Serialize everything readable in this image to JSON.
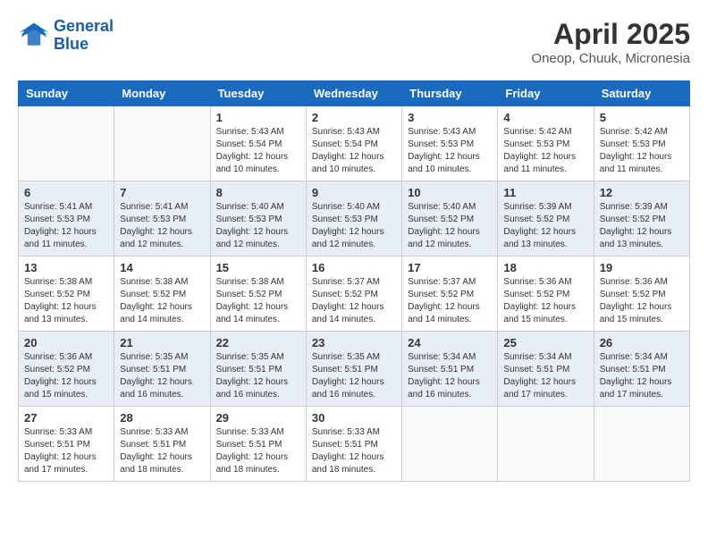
{
  "header": {
    "logo_line1": "General",
    "logo_line2": "Blue",
    "month": "April 2025",
    "location": "Oneop, Chuuk, Micronesia"
  },
  "weekdays": [
    "Sunday",
    "Monday",
    "Tuesday",
    "Wednesday",
    "Thursday",
    "Friday",
    "Saturday"
  ],
  "weeks": [
    [
      {
        "day": "",
        "info": ""
      },
      {
        "day": "",
        "info": ""
      },
      {
        "day": "1",
        "info": "Sunrise: 5:43 AM\nSunset: 5:54 PM\nDaylight: 12 hours\nand 10 minutes."
      },
      {
        "day": "2",
        "info": "Sunrise: 5:43 AM\nSunset: 5:54 PM\nDaylight: 12 hours\nand 10 minutes."
      },
      {
        "day": "3",
        "info": "Sunrise: 5:43 AM\nSunset: 5:53 PM\nDaylight: 12 hours\nand 10 minutes."
      },
      {
        "day": "4",
        "info": "Sunrise: 5:42 AM\nSunset: 5:53 PM\nDaylight: 12 hours\nand 11 minutes."
      },
      {
        "day": "5",
        "info": "Sunrise: 5:42 AM\nSunset: 5:53 PM\nDaylight: 12 hours\nand 11 minutes."
      }
    ],
    [
      {
        "day": "6",
        "info": "Sunrise: 5:41 AM\nSunset: 5:53 PM\nDaylight: 12 hours\nand 11 minutes."
      },
      {
        "day": "7",
        "info": "Sunrise: 5:41 AM\nSunset: 5:53 PM\nDaylight: 12 hours\nand 12 minutes."
      },
      {
        "day": "8",
        "info": "Sunrise: 5:40 AM\nSunset: 5:53 PM\nDaylight: 12 hours\nand 12 minutes."
      },
      {
        "day": "9",
        "info": "Sunrise: 5:40 AM\nSunset: 5:53 PM\nDaylight: 12 hours\nand 12 minutes."
      },
      {
        "day": "10",
        "info": "Sunrise: 5:40 AM\nSunset: 5:52 PM\nDaylight: 12 hours\nand 12 minutes."
      },
      {
        "day": "11",
        "info": "Sunrise: 5:39 AM\nSunset: 5:52 PM\nDaylight: 12 hours\nand 13 minutes."
      },
      {
        "day": "12",
        "info": "Sunrise: 5:39 AM\nSunset: 5:52 PM\nDaylight: 12 hours\nand 13 minutes."
      }
    ],
    [
      {
        "day": "13",
        "info": "Sunrise: 5:38 AM\nSunset: 5:52 PM\nDaylight: 12 hours\nand 13 minutes."
      },
      {
        "day": "14",
        "info": "Sunrise: 5:38 AM\nSunset: 5:52 PM\nDaylight: 12 hours\nand 14 minutes."
      },
      {
        "day": "15",
        "info": "Sunrise: 5:38 AM\nSunset: 5:52 PM\nDaylight: 12 hours\nand 14 minutes."
      },
      {
        "day": "16",
        "info": "Sunrise: 5:37 AM\nSunset: 5:52 PM\nDaylight: 12 hours\nand 14 minutes."
      },
      {
        "day": "17",
        "info": "Sunrise: 5:37 AM\nSunset: 5:52 PM\nDaylight: 12 hours\nand 14 minutes."
      },
      {
        "day": "18",
        "info": "Sunrise: 5:36 AM\nSunset: 5:52 PM\nDaylight: 12 hours\nand 15 minutes."
      },
      {
        "day": "19",
        "info": "Sunrise: 5:36 AM\nSunset: 5:52 PM\nDaylight: 12 hours\nand 15 minutes."
      }
    ],
    [
      {
        "day": "20",
        "info": "Sunrise: 5:36 AM\nSunset: 5:52 PM\nDaylight: 12 hours\nand 15 minutes."
      },
      {
        "day": "21",
        "info": "Sunrise: 5:35 AM\nSunset: 5:51 PM\nDaylight: 12 hours\nand 16 minutes."
      },
      {
        "day": "22",
        "info": "Sunrise: 5:35 AM\nSunset: 5:51 PM\nDaylight: 12 hours\nand 16 minutes."
      },
      {
        "day": "23",
        "info": "Sunrise: 5:35 AM\nSunset: 5:51 PM\nDaylight: 12 hours\nand 16 minutes."
      },
      {
        "day": "24",
        "info": "Sunrise: 5:34 AM\nSunset: 5:51 PM\nDaylight: 12 hours\nand 16 minutes."
      },
      {
        "day": "25",
        "info": "Sunrise: 5:34 AM\nSunset: 5:51 PM\nDaylight: 12 hours\nand 17 minutes."
      },
      {
        "day": "26",
        "info": "Sunrise: 5:34 AM\nSunset: 5:51 PM\nDaylight: 12 hours\nand 17 minutes."
      }
    ],
    [
      {
        "day": "27",
        "info": "Sunrise: 5:33 AM\nSunset: 5:51 PM\nDaylight: 12 hours\nand 17 minutes."
      },
      {
        "day": "28",
        "info": "Sunrise: 5:33 AM\nSunset: 5:51 PM\nDaylight: 12 hours\nand 18 minutes."
      },
      {
        "day": "29",
        "info": "Sunrise: 5:33 AM\nSunset: 5:51 PM\nDaylight: 12 hours\nand 18 minutes."
      },
      {
        "day": "30",
        "info": "Sunrise: 5:33 AM\nSunset: 5:51 PM\nDaylight: 12 hours\nand 18 minutes."
      },
      {
        "day": "",
        "info": ""
      },
      {
        "day": "",
        "info": ""
      },
      {
        "day": "",
        "info": ""
      }
    ]
  ]
}
